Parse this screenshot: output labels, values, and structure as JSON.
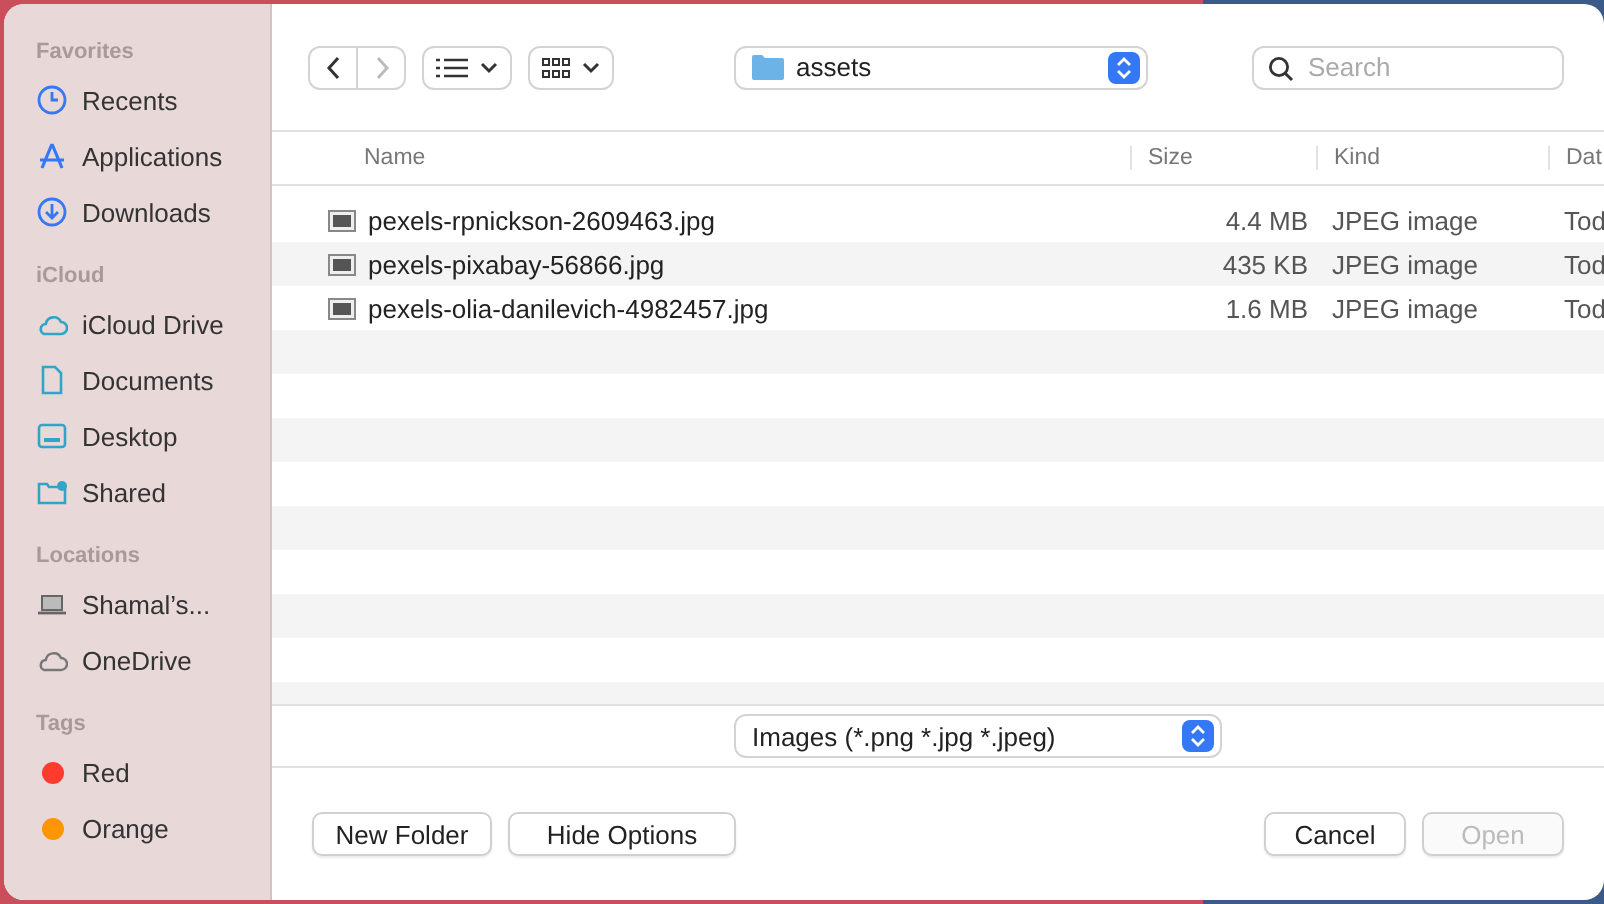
{
  "sidebar": {
    "sections": [
      {
        "title": "Favorites",
        "items": [
          {
            "label": "Recents",
            "kind": "clock"
          },
          {
            "label": "Applications",
            "kind": "apps"
          },
          {
            "label": "Downloads",
            "kind": "download"
          }
        ]
      },
      {
        "title": "iCloud",
        "items": [
          {
            "label": "iCloud Drive",
            "kind": "cloud"
          },
          {
            "label": "Documents",
            "kind": "doc"
          },
          {
            "label": "Desktop",
            "kind": "desktop"
          },
          {
            "label": "Shared",
            "kind": "shared"
          }
        ]
      },
      {
        "title": "Locations",
        "items": [
          {
            "label": "Shamal’s...",
            "kind": "laptop"
          },
          {
            "label": "OneDrive",
            "kind": "graycloud"
          }
        ]
      },
      {
        "title": "Tags",
        "items": [
          {
            "label": "Red",
            "kind": "tag",
            "color": "#ff3b30"
          },
          {
            "label": "Orange",
            "kind": "tag",
            "color": "#ff9500"
          }
        ]
      }
    ]
  },
  "toolbar": {
    "location": "assets",
    "search": {
      "placeholder": "Search"
    }
  },
  "table": {
    "columns": [
      "Name",
      "Size",
      "Kind",
      "Dat"
    ],
    "rows": [
      {
        "name": "pexels-rpnickson-2609463.jpg",
        "size": "4.4 MB",
        "kind": "JPEG image",
        "column_4": "Tod"
      },
      {
        "name": "pexels-pixabay-56866.jpg",
        "size": "435 KB",
        "kind": "JPEG image",
        "column_4": "Tod"
      },
      {
        "name": "pexels-olia-danilevich-4982457.jpg",
        "size": "1.6 MB",
        "kind": "JPEG image",
        "column_4": "Tod"
      }
    ]
  },
  "filter": "Images (*.png *.jpg *.jpeg)",
  "buttons_left": [
    {
      "label": "New Folder",
      "disabled": false
    },
    {
      "label": "Hide Options",
      "disabled": false
    }
  ],
  "buttons_right": [
    {
      "label": "Cancel",
      "disabled": false
    },
    {
      "label": "Open",
      "disabled": true
    }
  ]
}
